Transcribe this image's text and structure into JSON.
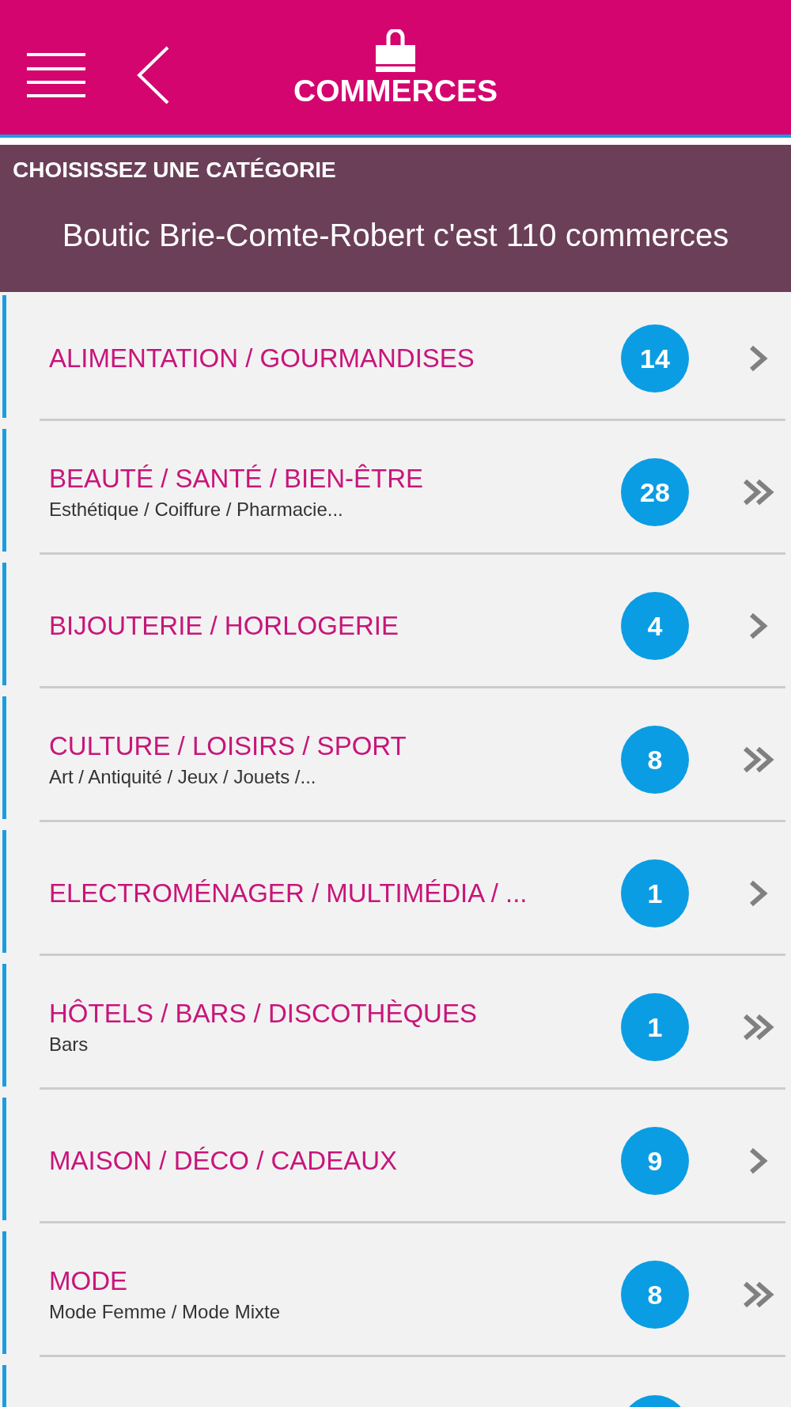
{
  "header": {
    "title": "COMMERCES"
  },
  "banner": {
    "heading": "CHOISISSEZ UNE CATÉGORIE",
    "summary": "Boutic Brie-Comte-Robert c'est 110 commerces"
  },
  "categories": [
    {
      "kind": "full",
      "title": "ALIMENTATION / GOURMANDISES",
      "count": "14",
      "expandable": false
    },
    {
      "kind": "full",
      "title": "BEAUTÉ / SANTÉ / BIEN-ÊTRE",
      "subtitle": "Esthétique / Coiffure / Pharmacie...",
      "count": "28",
      "expandable": true
    },
    {
      "kind": "full",
      "title": "BIJOUTERIE / HORLOGERIE",
      "count": "4",
      "expandable": false
    },
    {
      "kind": "full",
      "title": "CULTURE / LOISIRS / SPORT",
      "subtitle": "Art / Antiquité / Jeux / Jouets /...",
      "count": "8",
      "expandable": true
    },
    {
      "kind": "full",
      "title": "ELECTROMÉNAGER / MULTIMÉDIA / ...",
      "count": "1",
      "expandable": false
    },
    {
      "kind": "full",
      "title": "HÔTELS / BARS / DISCOTHÈQUES",
      "subtitle": "Bars",
      "count": "1",
      "expandable": true
    },
    {
      "kind": "full",
      "title": "MAISON / DÉCO / CADEAUX",
      "count": "9",
      "expandable": false
    },
    {
      "kind": "full",
      "title": "MODE",
      "subtitle": "Mode Femme / Mode Mixte",
      "count": "8",
      "expandable": true
    },
    {
      "kind": "cut"
    }
  ]
}
